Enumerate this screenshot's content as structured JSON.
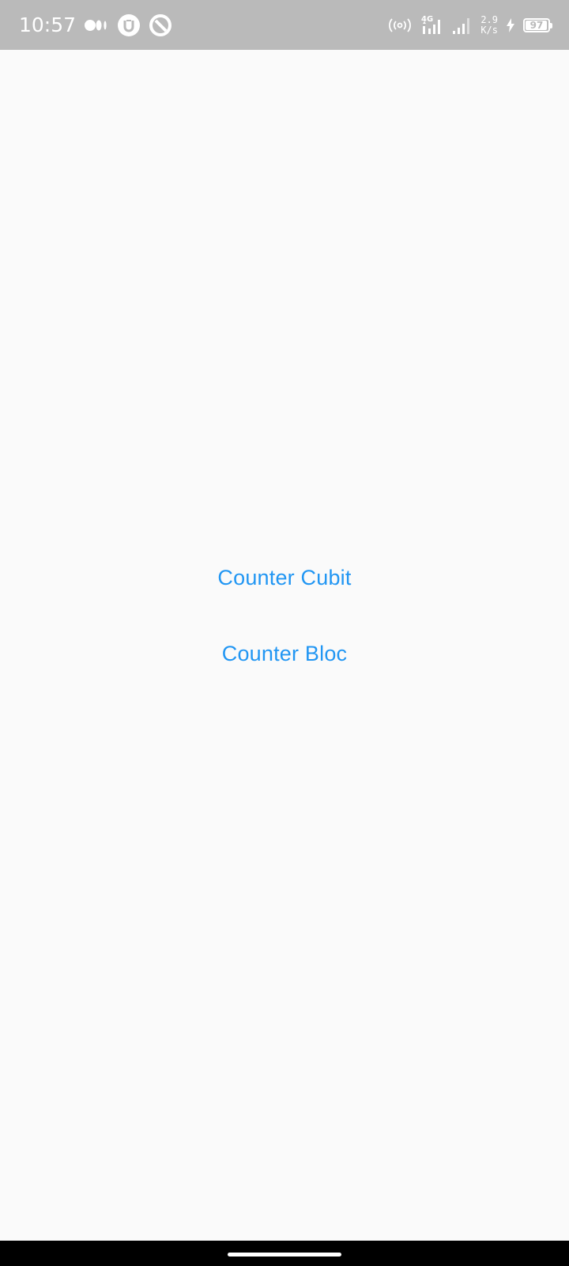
{
  "status_bar": {
    "time": "10:57",
    "left_icons": [
      "media-dots-icon",
      "u-app-icon",
      "q-app-icon"
    ],
    "network_type": "4G",
    "speed_value": "2.9",
    "speed_unit": "K/s",
    "battery_level": "97",
    "battery_fraction": 0.97,
    "charging": true,
    "background_color": "#bababa"
  },
  "main": {
    "buttons": [
      {
        "label": "Counter Cubit"
      },
      {
        "label": "Counter Bloc"
      }
    ],
    "accent_color": "#2196f3",
    "background_color": "#fafafa"
  },
  "nav_bar": {
    "background_color": "#000000",
    "home_indicator": "home-pill-icon"
  }
}
